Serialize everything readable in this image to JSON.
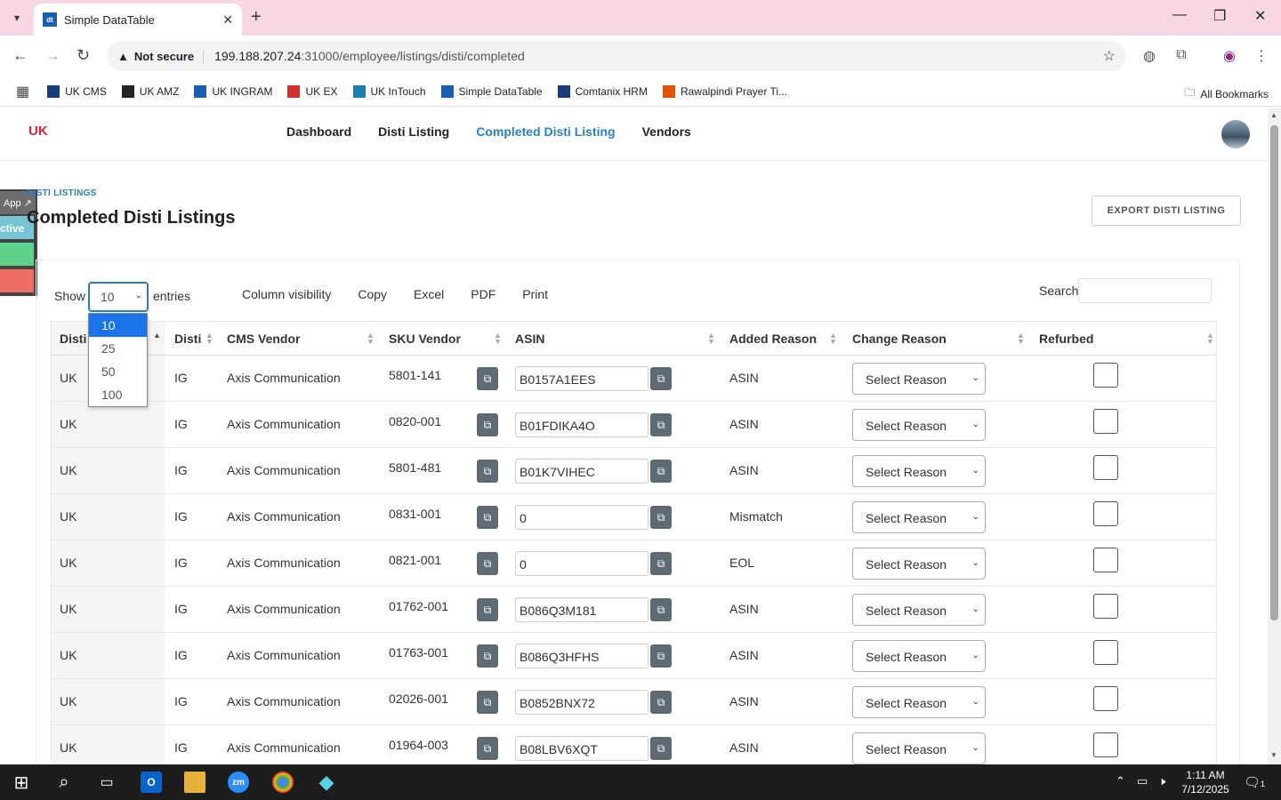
{
  "browser": {
    "tab_title": "Simple DataTable",
    "tab_favicon": "dt",
    "not_secure_label": "Not secure",
    "url_host": "199.188.207.24",
    "url_path": ":31000/employee/listings/disti/completed",
    "bookmarks": [
      {
        "label": "UK CMS",
        "icon": "uk-cms-icon",
        "color": "#1b3c7a"
      },
      {
        "label": "UK AMZ",
        "icon": "amazon-icon",
        "color": "#222222"
      },
      {
        "label": "UK INGRAM",
        "icon": "ingram-icon",
        "color": "#1b5fb0"
      },
      {
        "label": "UK EX",
        "icon": "ex-icon",
        "color": "#d32f2f"
      },
      {
        "label": "UK InTouch",
        "icon": "intouch-icon",
        "color": "#1b7fb0"
      },
      {
        "label": "Simple DataTable",
        "icon": "datatable-icon",
        "color": "#1b5fb0"
      },
      {
        "label": "Comtanix HRM",
        "icon": "hrm-icon",
        "color": "#1b3c7a"
      },
      {
        "label": "Rawalpindi Prayer Ti...",
        "icon": "prayer-icon",
        "color": "#e65100"
      }
    ],
    "all_bookmarks_label": "All Bookmarks"
  },
  "nav": {
    "logo": "UK",
    "links": [
      {
        "label": "Dashboard",
        "active": false
      },
      {
        "label": "Disti Listing",
        "active": false
      },
      {
        "label": "Completed Disti Listing",
        "active": true
      },
      {
        "label": "Vendors",
        "active": false
      }
    ]
  },
  "side_widget": {
    "app_label": "App ↗",
    "status_label": "ctive",
    "colors": [
      "#76c5d4",
      "#5fd18a",
      "#ef6e63"
    ]
  },
  "header": {
    "breadcrumb": "DISTI LISTINGS",
    "title": "Completed Disti Listings",
    "export_button": "EXPORT DISTI LISTING"
  },
  "controls": {
    "show_label": "Show",
    "entries_label": "entries",
    "page_length": "10",
    "page_length_options": [
      "10",
      "25",
      "50",
      "100"
    ],
    "buttons": [
      "Column visibility",
      "Copy",
      "Excel",
      "PDF",
      "Print"
    ],
    "search_label": "Search",
    "search_value": ""
  },
  "table": {
    "columns": [
      "Disti",
      "Disti",
      "CMS Vendor",
      "SKU Vendor",
      "ASIN",
      "Added Reason",
      "Change Reason",
      "Refurbed"
    ],
    "select_placeholder": "Select Reason",
    "rows": [
      {
        "disti": "UK",
        "disti2": "IG",
        "vendor": "Axis Communication",
        "sku": "5801-141",
        "asin": "B0157A1EES",
        "reason": "ASIN"
      },
      {
        "disti": "UK",
        "disti2": "IG",
        "vendor": "Axis Communication",
        "sku": "0820-001",
        "asin": "B01FDIKA4O",
        "reason": "ASIN"
      },
      {
        "disti": "UK",
        "disti2": "IG",
        "vendor": "Axis Communication",
        "sku": "5801-481",
        "asin": "B01K7VIHEC",
        "reason": "ASIN"
      },
      {
        "disti": "UK",
        "disti2": "IG",
        "vendor": "Axis Communication",
        "sku": "0831-001",
        "asin": "0",
        "reason": "Mismatch"
      },
      {
        "disti": "UK",
        "disti2": "IG",
        "vendor": "Axis Communication",
        "sku": "0821-001",
        "asin": "0",
        "reason": "EOL"
      },
      {
        "disti": "UK",
        "disti2": "IG",
        "vendor": "Axis Communication",
        "sku": "01762-001",
        "asin": "B086Q3M181",
        "reason": "ASIN"
      },
      {
        "disti": "UK",
        "disti2": "IG",
        "vendor": "Axis Communication",
        "sku": "01763-001",
        "asin": "B086Q3HFHS",
        "reason": "ASIN"
      },
      {
        "disti": "UK",
        "disti2": "IG",
        "vendor": "Axis Communication",
        "sku": "02026-001",
        "asin": "B0852BNX72",
        "reason": "ASIN"
      },
      {
        "disti": "UK",
        "disti2": "IG",
        "vendor": "Axis Communication",
        "sku": "01964-003",
        "asin": "B08LBV6XQT",
        "reason": "ASIN"
      }
    ]
  },
  "taskbar": {
    "time": "1:11 AM",
    "date": "7/12/2025",
    "notification_count": "1"
  }
}
